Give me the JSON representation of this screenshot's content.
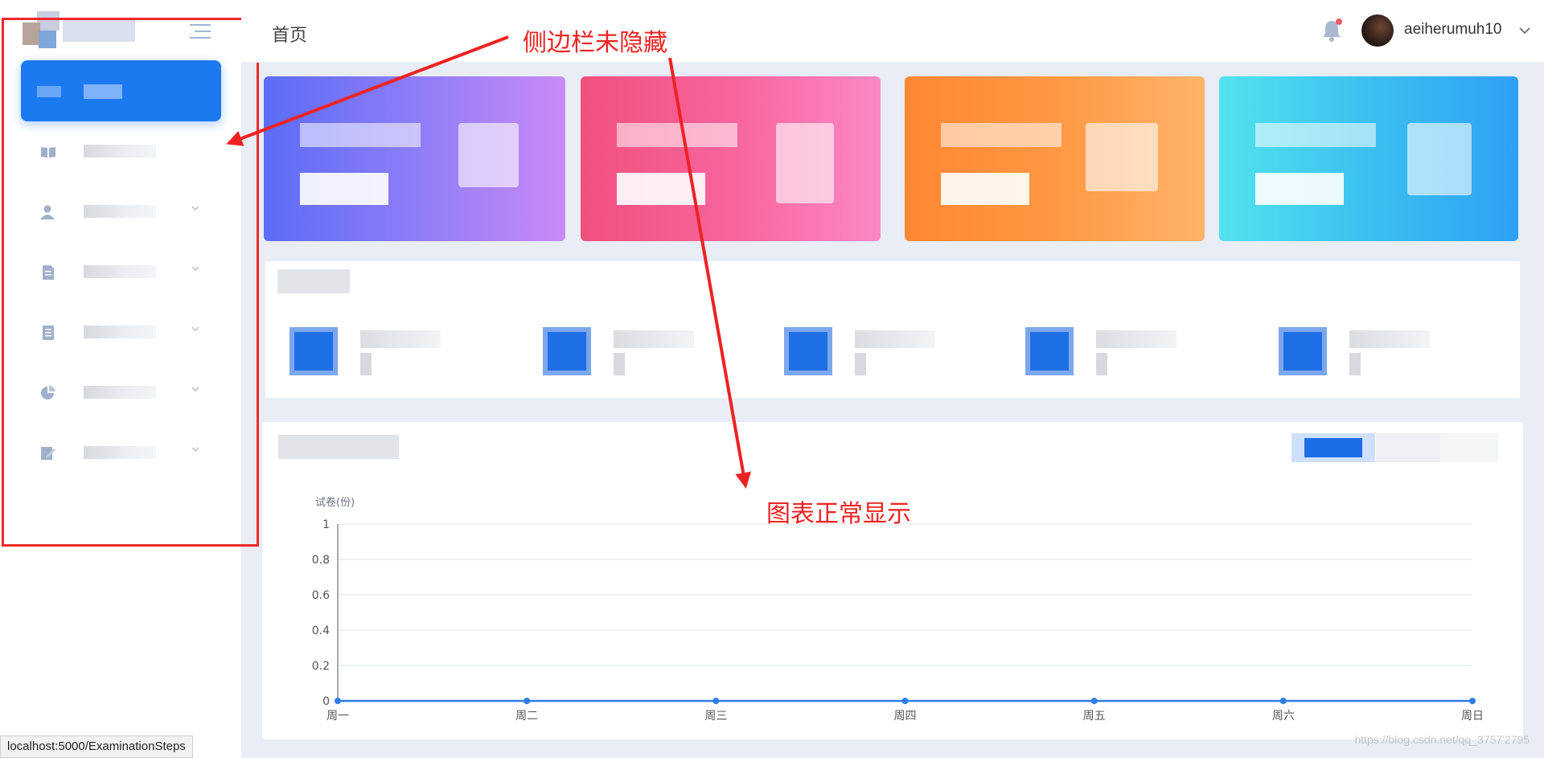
{
  "header": {
    "page_title": "首页",
    "username": "aeiherumuh10"
  },
  "annotations": {
    "sidebar_note": "侧边栏未隐藏",
    "chart_note": "图表正常显示"
  },
  "status_bar": {
    "url": "localhost:5000/ExaminationSteps"
  },
  "watermark": "https://blog.csdn.net/qq_3757'2795",
  "colors": {
    "sidebar_active": "#1c7af0",
    "card1_start": "#5b6cf7",
    "card1_end": "#c98af7",
    "card2_start": "#f0507e",
    "card2_end": "#fb88c4",
    "card3_start": "#ff8733",
    "card3_end": "#fdb46a",
    "card4_start": "#52e3ee",
    "card4_end": "#2fa0f5",
    "chart_line": "#2d7de8",
    "annotation": "#ee2222"
  },
  "sidebar": {
    "icons": [
      "home-icon",
      "book-icon",
      "user-icon",
      "document-icon",
      "paper-icon",
      "pie-chart-icon",
      "edit-icon"
    ]
  },
  "chart_data": {
    "type": "line",
    "ylabel": "试卷(份)",
    "categories": [
      "周一",
      "周二",
      "周三",
      "周四",
      "周五",
      "周六",
      "周日"
    ],
    "values": [
      0,
      0,
      0,
      0,
      0,
      0,
      0
    ],
    "ylim": [
      0,
      1
    ],
    "yticks": [
      "0",
      "0.2",
      "0.4",
      "0.6",
      "0.8",
      "1"
    ],
    "grid": true
  }
}
